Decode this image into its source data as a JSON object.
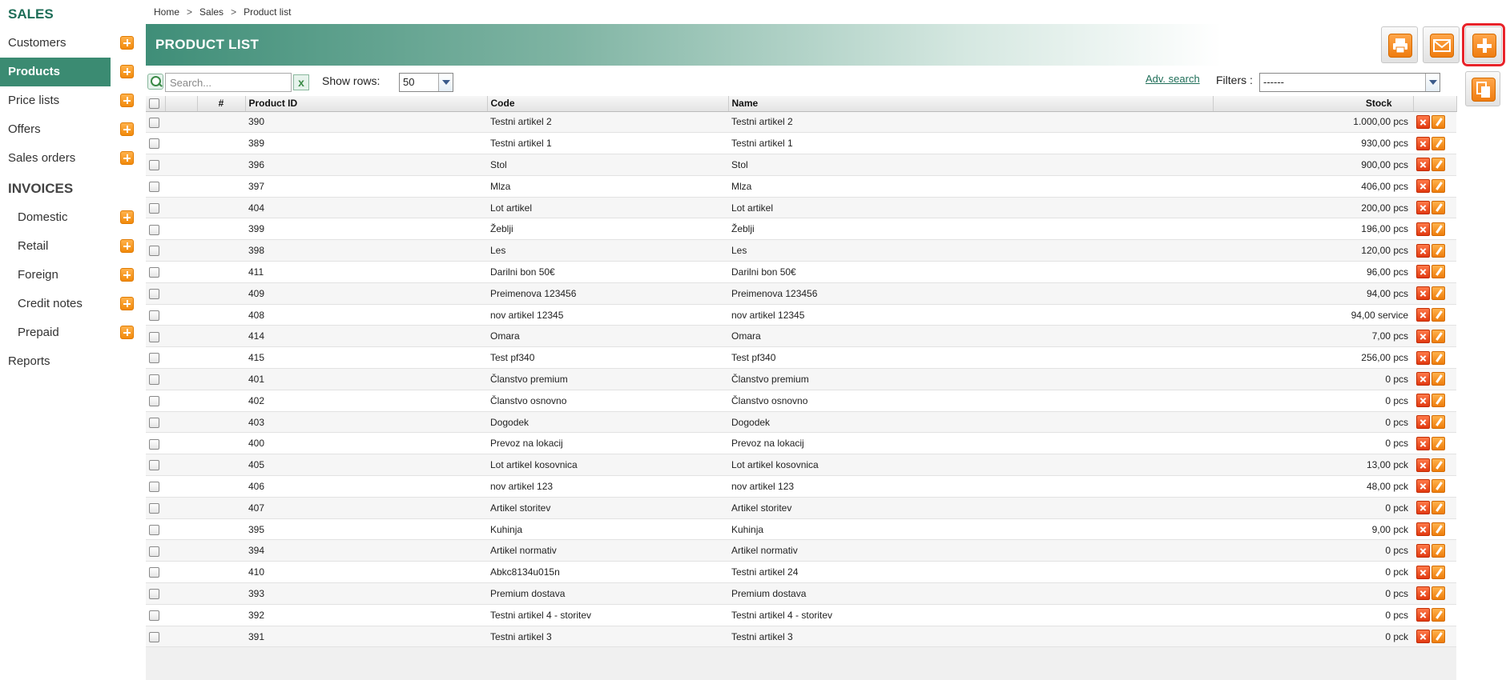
{
  "sidebar": {
    "heading": "SALES",
    "items": [
      {
        "label": "Customers"
      },
      {
        "label": "Products"
      },
      {
        "label": "Price lists"
      },
      {
        "label": "Offers"
      },
      {
        "label": "Sales orders"
      }
    ],
    "invoices_heading": "INVOICES",
    "invoice_items": [
      {
        "label": "Domestic"
      },
      {
        "label": "Retail"
      },
      {
        "label": "Foreign"
      },
      {
        "label": "Credit notes"
      },
      {
        "label": "Prepaid"
      }
    ],
    "reports": "Reports"
  },
  "breadcrumb": {
    "home": "Home",
    "sales": "Sales",
    "current": "Product list",
    "sep": ">"
  },
  "page_title": "PRODUCT LIST",
  "toolbar": {
    "search_placeholder": "Search...",
    "clear": "x",
    "show_rows_label": "Show rows:",
    "show_rows_value": "50",
    "adv_search": "Adv. search",
    "filters_label": "Filters :",
    "filters_value": "------"
  },
  "table": {
    "headers": {
      "num": "#",
      "product_id": "Product ID",
      "code": "Code",
      "name": "Name",
      "stock": "Stock"
    },
    "rows": [
      {
        "id": "390",
        "code": "Testni artikel 2",
        "name": "Testni artikel 2",
        "stock": "1.000,00 pcs"
      },
      {
        "id": "389",
        "code": "Testni artikel 1",
        "name": "Testni artikel 1",
        "stock": "930,00 pcs"
      },
      {
        "id": "396",
        "code": "Stol",
        "name": "Stol",
        "stock": "900,00 pcs"
      },
      {
        "id": "397",
        "code": "Mlza",
        "name": "Mlza",
        "stock": "406,00 pcs"
      },
      {
        "id": "404",
        "code": "Lot artikel",
        "name": "Lot artikel",
        "stock": "200,00 pcs"
      },
      {
        "id": "399",
        "code": "Žeblji",
        "name": "Žeblji",
        "stock": "196,00 pcs"
      },
      {
        "id": "398",
        "code": "Les",
        "name": "Les",
        "stock": "120,00 pcs"
      },
      {
        "id": "411",
        "code": "Darilni bon 50€",
        "name": "Darilni bon 50€",
        "stock": "96,00 pcs"
      },
      {
        "id": "409",
        "code": "Preimenova 123456",
        "name": "Preimenova 123456",
        "stock": "94,00 pcs"
      },
      {
        "id": "408",
        "code": "nov artikel 12345",
        "name": "nov artikel 12345",
        "stock": "94,00 service"
      },
      {
        "id": "414",
        "code": "Omara",
        "name": "Omara",
        "stock": "7,00 pcs"
      },
      {
        "id": "415",
        "code": "Test pf340",
        "name": "Test pf340",
        "stock": "256,00 pcs"
      },
      {
        "id": "401",
        "code": "Članstvo premium",
        "name": "Članstvo premium",
        "stock": "0 pcs"
      },
      {
        "id": "402",
        "code": "Članstvo osnovno",
        "name": "Članstvo osnovno",
        "stock": "0 pcs"
      },
      {
        "id": "403",
        "code": "Dogodek",
        "name": "Dogodek",
        "stock": "0 pcs"
      },
      {
        "id": "400",
        "code": "Prevoz na lokacij",
        "name": "Prevoz na lokacij",
        "stock": "0 pcs"
      },
      {
        "id": "405",
        "code": "Lot artikel kosovnica",
        "name": "Lot artikel kosovnica",
        "stock": "13,00 pck"
      },
      {
        "id": "406",
        "code": "nov artikel 123",
        "name": "nov artikel 123",
        "stock": "48,00 pck"
      },
      {
        "id": "407",
        "code": "Artikel storitev",
        "name": "Artikel storitev",
        "stock": "0 pck"
      },
      {
        "id": "395",
        "code": "Kuhinja",
        "name": "Kuhinja",
        "stock": "9,00 pck"
      },
      {
        "id": "394",
        "code": "Artikel normativ",
        "name": "Artikel normativ",
        "stock": "0 pcs"
      },
      {
        "id": "410",
        "code": "Abkc8134u015n",
        "name": "Testni artikel 24",
        "stock": "0 pck"
      },
      {
        "id": "393",
        "code": "Premium dostava",
        "name": "Premium dostava",
        "stock": "0 pcs"
      },
      {
        "id": "392",
        "code": "Testni artikel 4 - storitev",
        "name": "Testni artikel 4 - storitev",
        "stock": "0 pcs"
      },
      {
        "id": "391",
        "code": "Testni artikel 3",
        "name": "Testni artikel 3",
        "stock": "0 pck"
      }
    ]
  },
  "colors": {
    "accent": "#3b8b72",
    "action_orange": "#f28a0b",
    "delete_red": "#e23a10",
    "highlight": "#e8232a"
  },
  "icons": {
    "print": "printer-icon",
    "email": "envelope-icon",
    "add": "plus-icon",
    "copy": "copy-icon"
  }
}
